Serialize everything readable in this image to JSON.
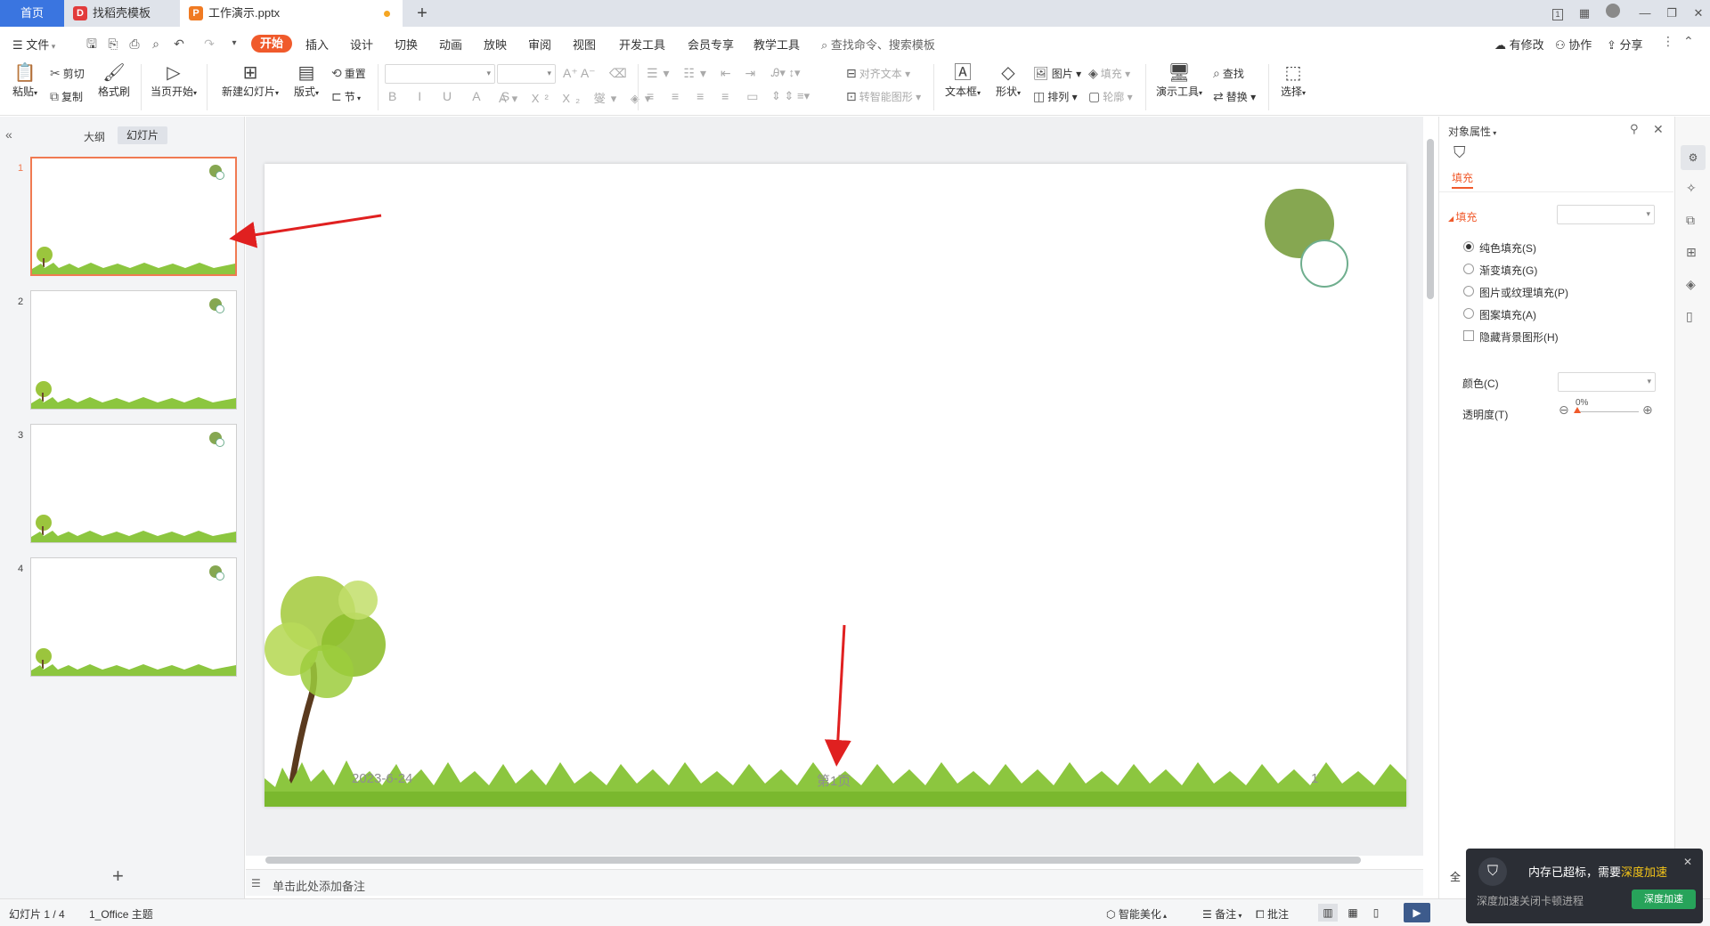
{
  "tabs": {
    "home": "首页",
    "template": "找稻壳模板",
    "doc": "工作演示.pptx",
    "add": "+"
  },
  "window": {
    "badge": "1"
  },
  "menu": {
    "file": "文件",
    "items": [
      "开始",
      "插入",
      "设计",
      "切换",
      "动画",
      "放映",
      "审阅",
      "视图",
      "开发工具",
      "会员专享",
      "教学工具"
    ],
    "search_placeholder": "查找命令、搜索模板",
    "right": [
      "有修改",
      "协作",
      "分享"
    ]
  },
  "ribbon": {
    "paste": "粘贴",
    "cut": "剪切",
    "copy": "复制",
    "format_painter": "格式刷",
    "play_from_current": "当页开始",
    "new_slide": "新建幻灯片",
    "layout": "版式",
    "reset": "重置",
    "section": "节",
    "align_text": "对齐文本",
    "smart_shape": "转智能图形",
    "text_box": "文本框",
    "shape": "形状",
    "picture": "图片",
    "fill": "填充",
    "arrange": "排列",
    "outline": "轮廓",
    "present_tools": "演示工具",
    "find": "查找",
    "replace": "替换",
    "select": "选择"
  },
  "left_panel": {
    "outline_tab": "大纲",
    "slides_tab": "幻灯片",
    "slide_numbers": [
      "1",
      "2",
      "3",
      "4"
    ],
    "add_slide": "+"
  },
  "slide": {
    "date": "2023-6-24",
    "page_label": "第1页",
    "page_number": "1",
    "accent_color": "#86a751"
  },
  "notes": {
    "placeholder": "单击此处添加备注"
  },
  "right_panel": {
    "title": "对象属性",
    "fill_tab": "填充",
    "section_fill": "填充",
    "options": [
      "纯色填充(S)",
      "渐变填充(G)",
      "图片或纹理填充(P)",
      "图案填充(A)"
    ],
    "hide_bg": "隐藏背景图形(H)",
    "color_label": "颜色(C)",
    "transparency_label": "透明度(T)",
    "transparency_value": "0%"
  },
  "status": {
    "slide_info": "幻灯片 1 / 4",
    "theme": "1_Office 主题",
    "smart_beautify": "智能美化",
    "notes": "备注",
    "comments": "批注"
  },
  "popup": {
    "title_part1": "内存已超标，需要",
    "title_link": "深度加速",
    "subtitle": "深度加速关闭卡顿进程",
    "button": "深度加速",
    "full_text_stub": "全"
  }
}
